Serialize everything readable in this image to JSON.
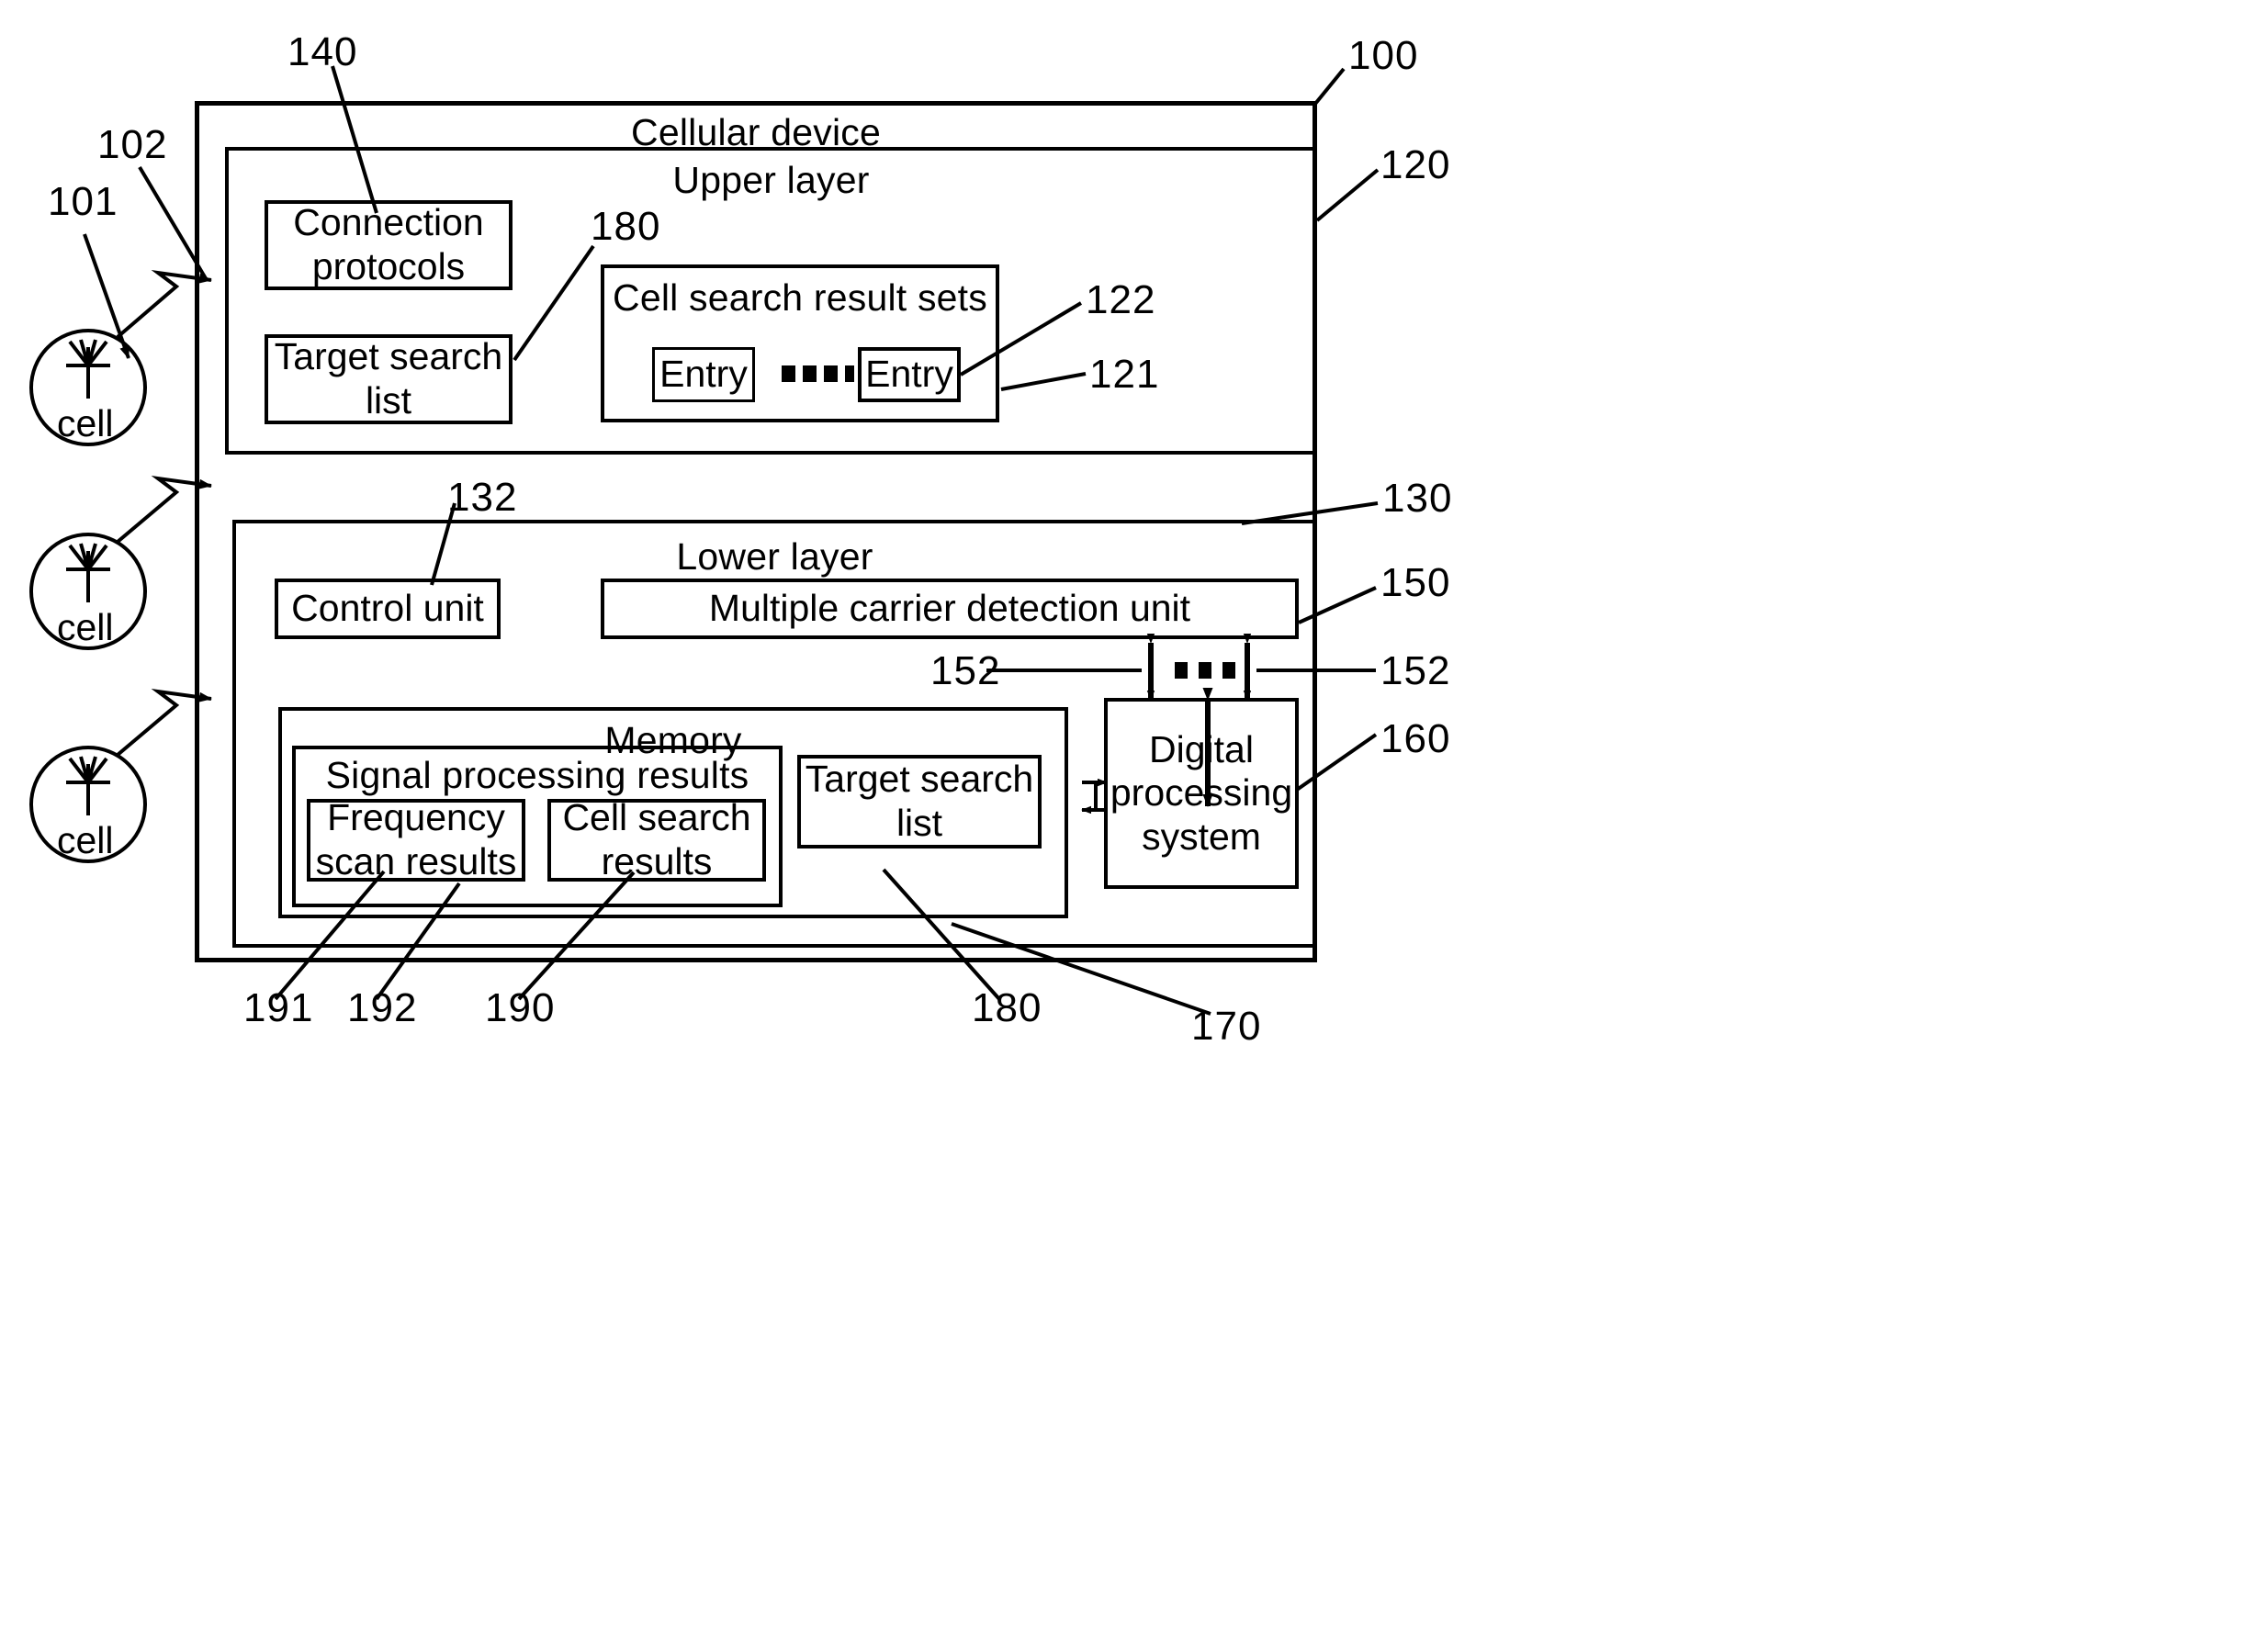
{
  "figure": {
    "type": "patent-block-diagram",
    "title_text": "Cellular device"
  },
  "outer": {
    "label": "Cellular device",
    "ref": "100"
  },
  "network": {
    "system_ref": "101",
    "link_ref": "102",
    "cells": [
      {
        "label": "cell",
        "icon": "antenna-icon"
      },
      {
        "label": "cell",
        "icon": "antenna-icon"
      },
      {
        "label": "cell",
        "icon": "antenna-icon"
      }
    ]
  },
  "upper_layer": {
    "label": "Upper layer",
    "ref": "120",
    "connection_protocols": {
      "label": "Connection\nprotocols",
      "ref": "140"
    },
    "target_search_list": {
      "label": "Target search\nlist",
      "ref": "180"
    },
    "cell_search_result_sets": {
      "label": "Cell search result sets",
      "ref": "121",
      "entry_ref": "122",
      "entries": [
        {
          "label": "Entry"
        },
        {
          "label": "Entry"
        }
      ],
      "ellipsis_dots": 4
    }
  },
  "lower_layer": {
    "label": "Lower layer",
    "ref": "130",
    "control_unit": {
      "label": "Control unit",
      "ref": "132"
    },
    "multiple_carrier_detection_unit": {
      "label": "Multiple carrier detection unit",
      "ref": "150"
    },
    "interface_ref_left": "152",
    "interface_ref_right": "152",
    "interface_dots": 3,
    "memory": {
      "label": "Memory",
      "ref": "190",
      "signal_processing_results": {
        "label": "Signal processing results",
        "ref": "192",
        "frequency_scan_results": {
          "label": "Frequency\nscan results",
          "ref": "191"
        },
        "cell_search_results": {
          "label": "Cell search\nresults"
        }
      },
      "target_search_list": {
        "label": "Target search\nlist",
        "ref": "180"
      }
    },
    "digital_processing_system": {
      "label": "Digital\nprocessing\nsystem",
      "ref": "160"
    },
    "memory_bus_ref": "170"
  },
  "reference_numerals": [
    "100",
    "101",
    "102",
    "120",
    "121",
    "122",
    "130",
    "132",
    "140",
    "150",
    "152",
    "160",
    "170",
    "180",
    "190",
    "191",
    "192"
  ],
  "colors": {
    "ink": "#000000",
    "paper": "#ffffff"
  }
}
